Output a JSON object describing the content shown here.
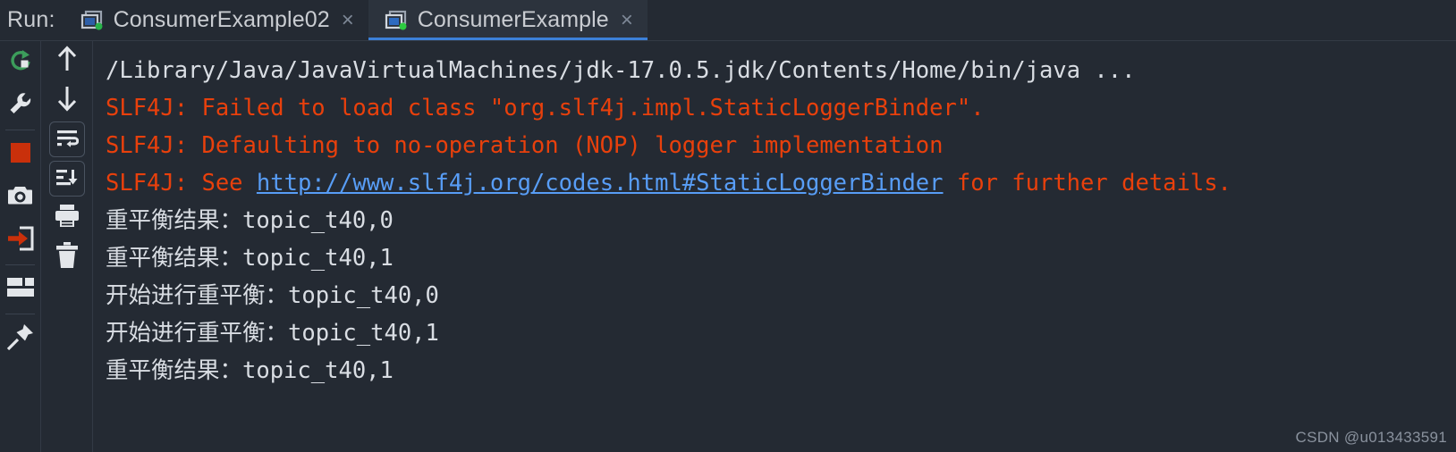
{
  "window": {
    "run_label": "Run:",
    "background_color": "#242A33",
    "active_tab_underline_color": "#3C80D8"
  },
  "tabs": [
    {
      "label": "ConsumerExample02",
      "icon": "run-configuration-icon",
      "close_glyph": "×",
      "active": false
    },
    {
      "label": "ConsumerExample",
      "icon": "run-configuration-icon",
      "close_glyph": "×",
      "active": true
    }
  ],
  "toolbar_left": [
    {
      "name": "rerun-button",
      "icon": "rerun-icon",
      "tooltip": "Rerun"
    },
    {
      "name": "edit-configuration",
      "icon": "wrench-icon",
      "tooltip": "Edit Configuration"
    },
    {
      "name": "stop-button",
      "icon": "stop-square-icon",
      "tooltip": "Stop"
    },
    {
      "name": "dump-threads-button",
      "icon": "camera-icon",
      "tooltip": "Dump Threads"
    },
    {
      "name": "exit-button",
      "icon": "exit-arrow-icon",
      "tooltip": "Exit"
    },
    {
      "name": "layout-button",
      "icon": "layout-icon",
      "tooltip": "Layout Settings"
    },
    {
      "name": "pin-tab-button",
      "icon": "pin-icon",
      "tooltip": "Pin Tab"
    }
  ],
  "toolbar_console": [
    {
      "name": "up-the-stack-trace",
      "icon": "arrow-up-icon",
      "tooltip": "Up the Stack Trace"
    },
    {
      "name": "down-the-stack-trace",
      "icon": "arrow-down-icon",
      "tooltip": "Down the Stack Trace"
    },
    {
      "name": "soft-wrap-toggle",
      "icon": "soft-wrap-icon",
      "tooltip": "Soft-Wrap"
    },
    {
      "name": "scroll-to-end-toggle",
      "icon": "scroll-to-end-icon",
      "tooltip": "Scroll to the end"
    },
    {
      "name": "print-button",
      "icon": "printer-icon",
      "tooltip": "Print"
    },
    {
      "name": "clear-all-button",
      "icon": "trash-icon",
      "tooltip": "Clear All"
    }
  ],
  "console": {
    "lines": [
      {
        "id": "line1",
        "color": "white",
        "text": "/Library/Java/JavaVirtualMachines/jdk-17.0.5.jdk/Contents/Home/bin/java ..."
      },
      {
        "id": "line2",
        "color": "red",
        "text": "SLF4J: Failed to load class \"org.slf4j.impl.StaticLoggerBinder\"."
      },
      {
        "id": "line3",
        "color": "red",
        "text": "SLF4J: Defaulting to no-operation (NOP) logger implementation"
      },
      {
        "id": "line4",
        "color": "red",
        "prefix": "SLF4J: See ",
        "link": "http://www.slf4j.org/codes.html#StaticLoggerBinder",
        "suffix": " for further details."
      },
      {
        "id": "line5",
        "color": "white",
        "text": "重平衡结果：topic_t40,0"
      },
      {
        "id": "line6",
        "color": "white",
        "text": "重平衡结果：topic_t40,1"
      },
      {
        "id": "line7",
        "color": "white",
        "text": "开始进行重平衡：topic_t40,0"
      },
      {
        "id": "line8",
        "color": "white",
        "text": "开始进行重平衡：topic_t40,1"
      },
      {
        "id": "line9",
        "color": "white",
        "text": "重平衡结果：topic_t40,1"
      }
    ],
    "text_color_normal": "#D9DDE3",
    "text_color_error": "#E8400C",
    "link_color": "#589DF6"
  },
  "watermark": {
    "text": "CSDN @u013433591"
  }
}
